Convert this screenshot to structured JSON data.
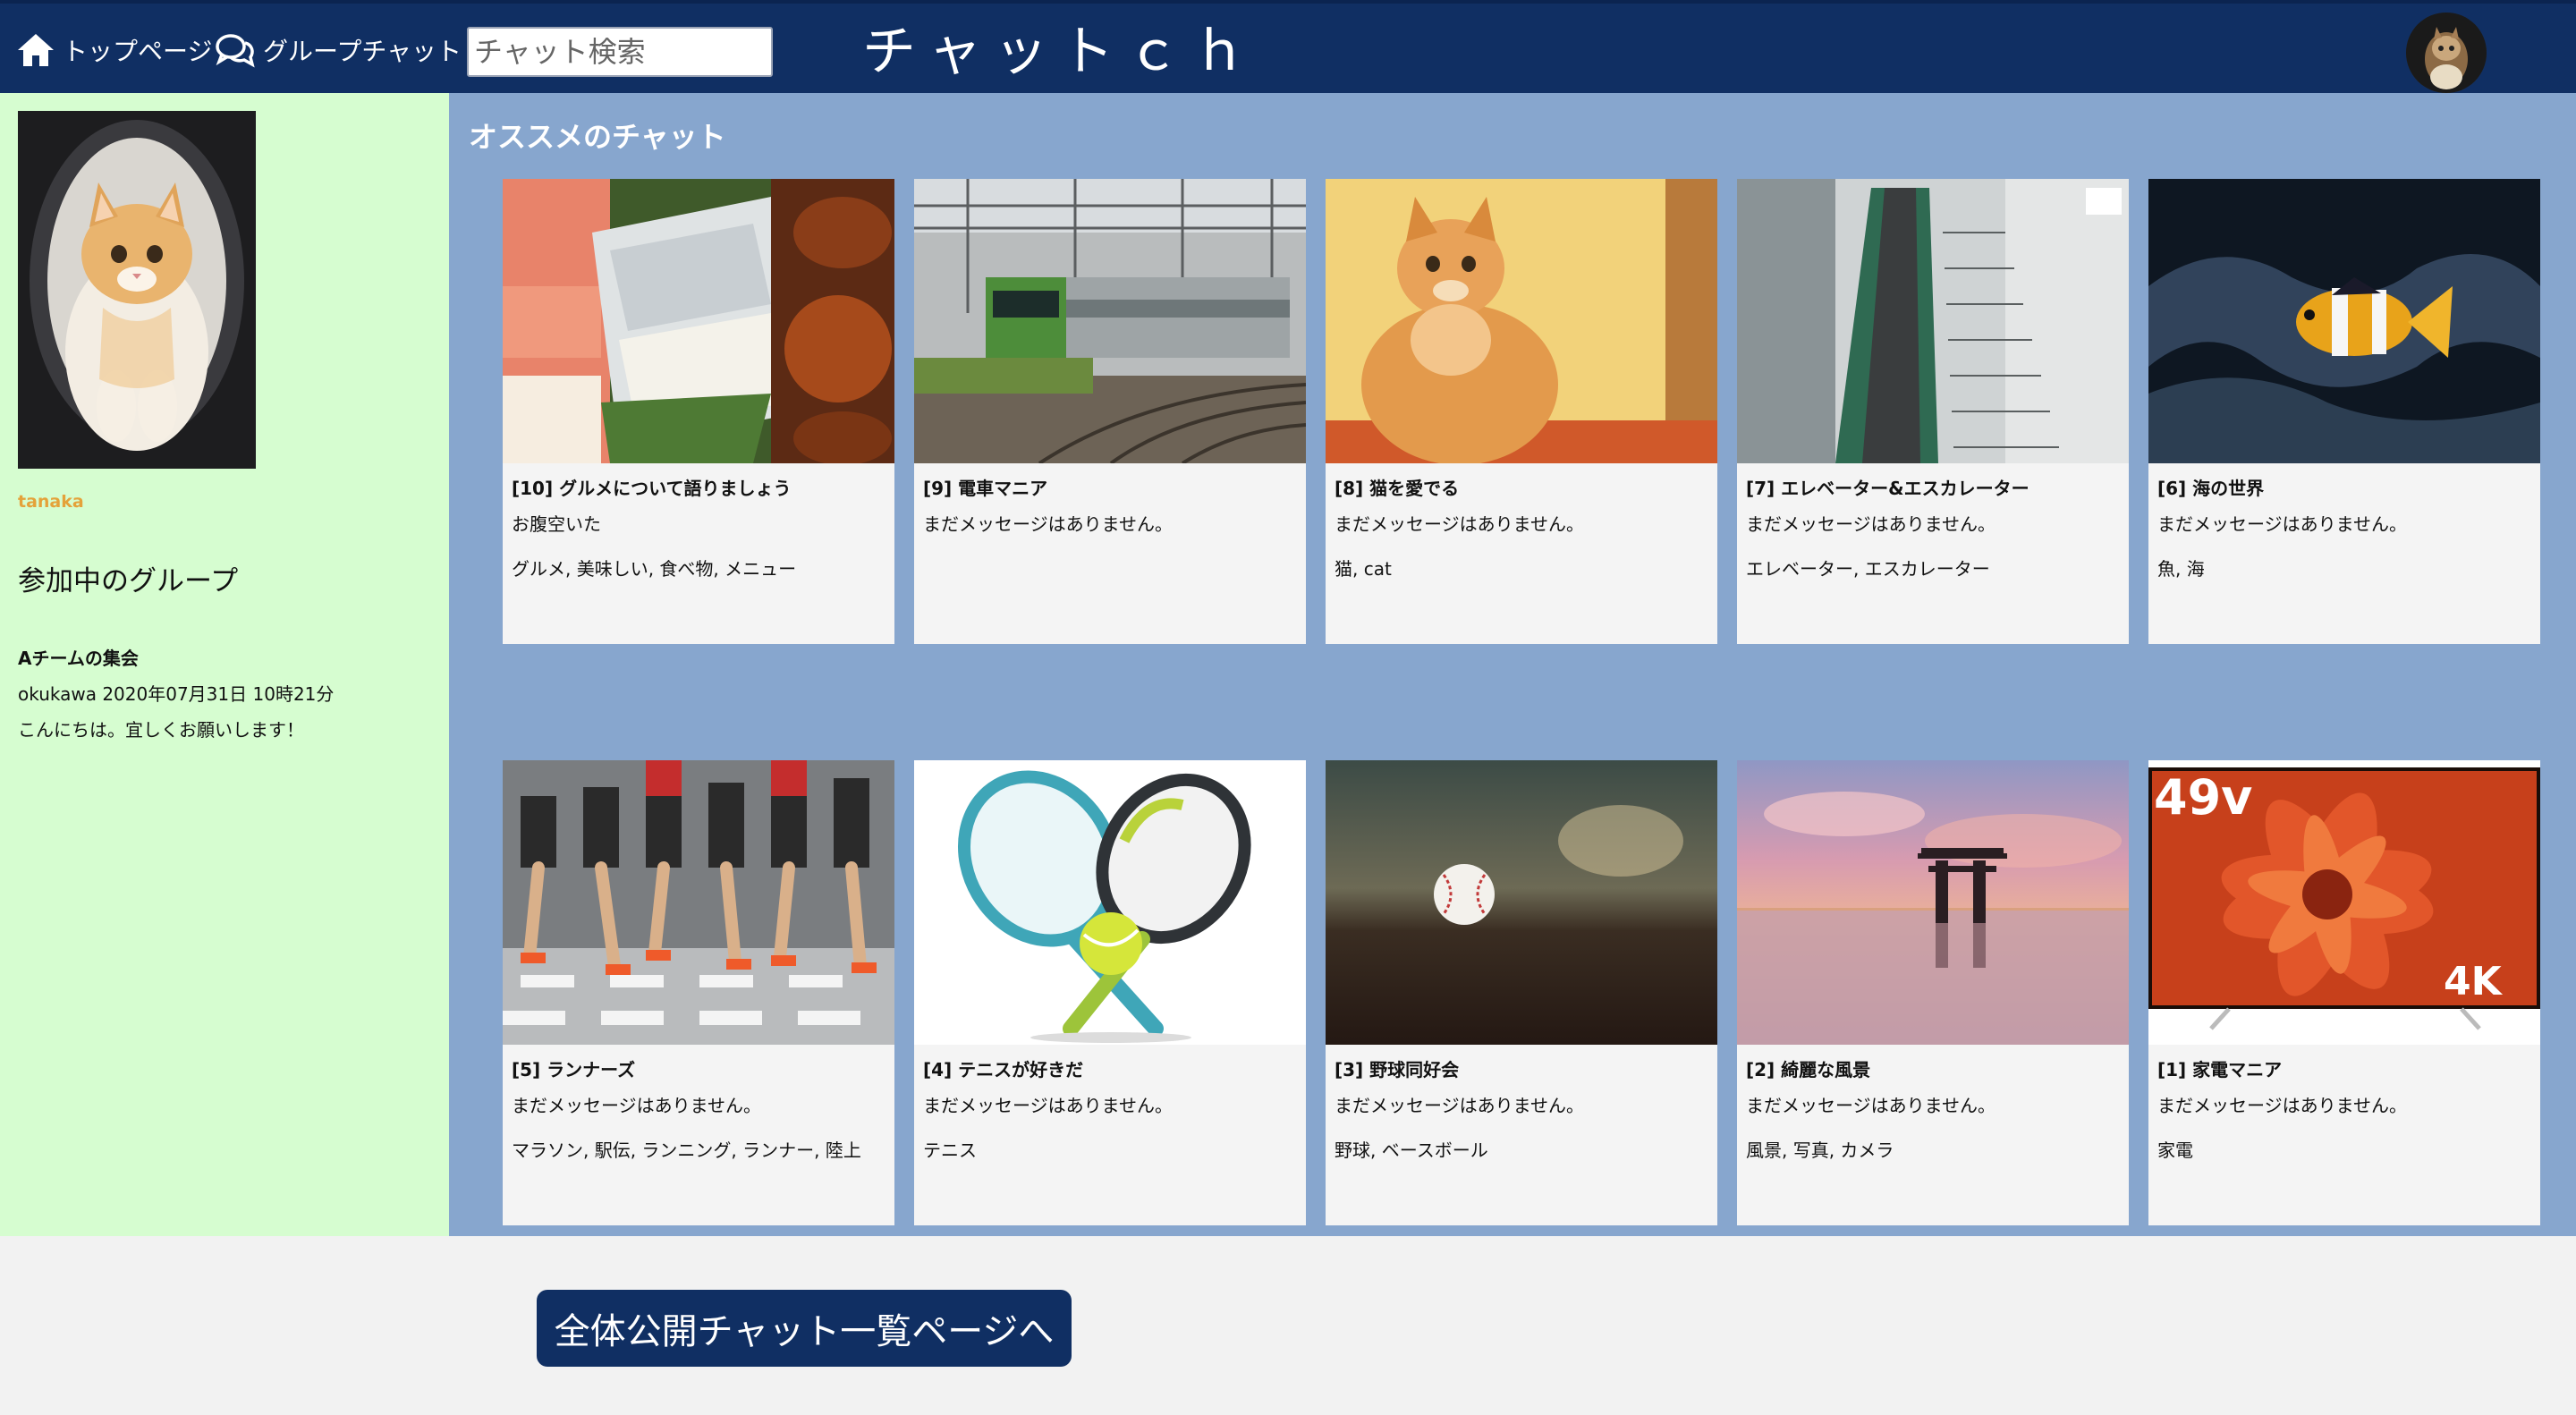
{
  "header": {
    "home_label": "トップページ",
    "group_chat_label": "グループチャット",
    "search_placeholder": "チャット検索",
    "site_title": "チャットｃｈ"
  },
  "sidebar": {
    "username": "tanaka",
    "groups_heading": "参加中のグループ",
    "groups": [
      {
        "name": "Aチームの集会",
        "meta": "okukawa  2020年07月31日 10時21分",
        "message": "こんにちは。宜しくお願いします！"
      }
    ]
  },
  "main": {
    "section_title": "オススメのチャット",
    "cards": [
      {
        "title": "[10] グルメについて語りましょう",
        "message": "お腹空いた",
        "tags": "グルメ, 美味しい, 食べ物, メニュー",
        "image": "sushi-image"
      },
      {
        "title": "[9] 電車マニア",
        "message": "まだメッセージはありません。",
        "tags": "",
        "image": "train-image"
      },
      {
        "title": "[8] 猫を愛でる",
        "message": "まだメッセージはありません。",
        "tags": "猫, cat",
        "image": "cat-image"
      },
      {
        "title": "[7] エレベーター&エスカレーター",
        "message": "まだメッセージはありません。",
        "tags": "エレベーター, エスカレーター",
        "image": "escalator-image"
      },
      {
        "title": "[6] 海の世界",
        "message": "まだメッセージはありません。",
        "tags": "魚, 海",
        "image": "clownfish-image"
      },
      {
        "title": "[5] ランナーズ",
        "message": "まだメッセージはありません。",
        "tags": "マラソン, 駅伝, ランニング, ランナー, 陸上",
        "image": "runners-image"
      },
      {
        "title": "[4] テニスが好きだ",
        "message": "まだメッセージはありません。",
        "tags": "テニス",
        "image": "tennis-image"
      },
      {
        "title": "[3] 野球同好会",
        "message": "まだメッセージはありません。",
        "tags": "野球, ベースボール",
        "image": "baseball-image"
      },
      {
        "title": "[2] 綺麗な風景",
        "message": "まだメッセージはありません。",
        "tags": "風景, 写真, カメラ",
        "image": "torii-image"
      },
      {
        "title": "[1] 家電マニア",
        "message": "まだメッセージはありません。",
        "tags": "家電",
        "image": "tv-image",
        "overlay_top": "49v",
        "overlay_bottom": "4K"
      }
    ]
  },
  "footer": {
    "all_chats_button": "全体公開チャット一覧ページへ"
  },
  "colors": {
    "header_bg": "#102f63",
    "sidebar_bg": "#d6fdd0",
    "main_bg": "#87a6ce",
    "card_bg": "#f4f4f4",
    "username": "#e4a23a"
  }
}
